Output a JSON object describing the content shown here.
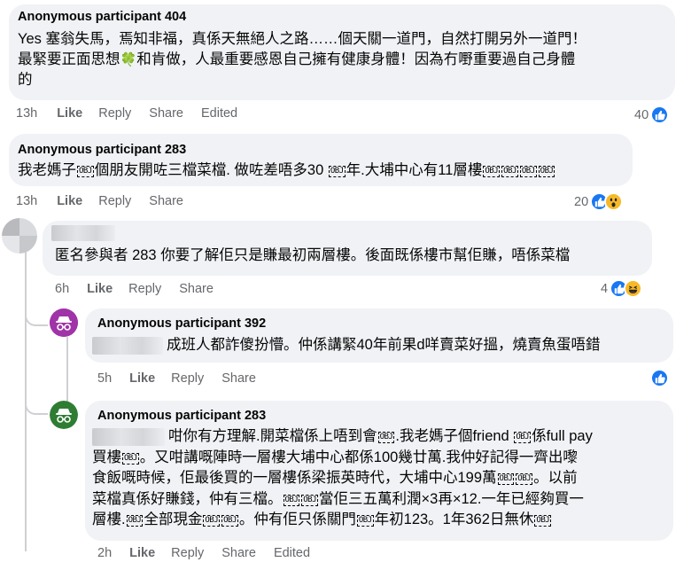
{
  "comments": [
    {
      "author": "Anonymous participant 404",
      "lines": [
        "Yes 塞翁失馬，焉知非福，真係天無絕人之路……個天關一道門，自然打開另外一道門！",
        "最緊要正面思想",
        "和肯做，人最重要感恩自己擁有健康身體！因為冇嘢重要過自己身體",
        "的"
      ],
      "time": "13h",
      "like": "Like",
      "reply": "Reply",
      "share": "Share",
      "edited": "Edited",
      "reaction_count": "40"
    },
    {
      "author": "Anonymous participant 283",
      "lines": [
        "我老媽子",
        "個朋友開咗三檔菜檔. 做咗差唔多30 ",
        "年.大埔中心有11層樓"
      ],
      "time": "13h",
      "like": "Like",
      "reply": "Reply",
      "share": "Share",
      "reaction_count": "20"
    },
    {
      "author": "",
      "lines": [
        "匿名參與者 283 你要了解佢只是賺最初兩層樓。後面既係樓市幫佢賺，唔係菜檔"
      ],
      "time": "6h",
      "like": "Like",
      "reply": "Reply",
      "share": "Share",
      "reaction_count": "4"
    },
    {
      "author": "Anonymous participant 392",
      "lines": [
        "成班人都詐傻扮懵。仲係講緊40年前果d咩賣菜好搵，燒賣魚蛋唔錯"
      ],
      "time": "5h",
      "like": "Like",
      "reply": "Reply",
      "share": "Share"
    },
    {
      "author": "Anonymous participant 283",
      "lines": [
        "咁你有方理解.開菜檔係上唔到會",
        ".我老媽子個friend ",
        "係full pay",
        "買樓",
        "。又咁講嘅陣時一層樓大埔中心都係100幾廿萬.我仲好記得一齊出嚟",
        "食飯嘅時候，佢最後買的一層樓係梁振英時代，大埔中心199萬",
        "。以前",
        "菜檔真係好賺錢，仲有三檔。",
        "當佢三五萬利潤×3再×12.一年已經夠買一",
        "層樓.",
        "全部現金",
        "。仲有佢只係關門",
        "年初123。1年362日無休"
      ],
      "time": "2h",
      "like": "Like",
      "reply": "Reply",
      "share": "Share",
      "edited": "Edited"
    }
  ],
  "obj": "OBJ",
  "colors": {
    "bubble": "#f0f2f5",
    "meta": "#65676b",
    "like_blue": "#1877f2",
    "avatar_purple": "#a033a8",
    "avatar_green": "#2e7d32"
  }
}
